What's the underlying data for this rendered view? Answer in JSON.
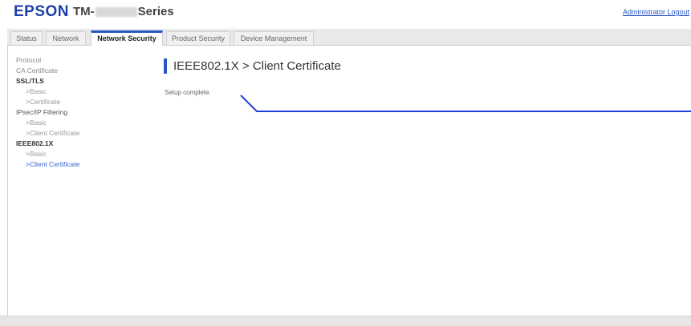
{
  "header": {
    "brand": "EPSON",
    "model_prefix": "TM-",
    "model_suffix": "Series",
    "admin_link": "Administrator Logout"
  },
  "tabs": [
    {
      "label": "Status"
    },
    {
      "label": "Network"
    },
    {
      "label": "Network Security"
    },
    {
      "label": "Product Security"
    },
    {
      "label": "Device Management"
    }
  ],
  "sidebar": {
    "items": [
      {
        "label": "Protocol"
      },
      {
        "label": "CA Certificate"
      },
      {
        "label": "SSL/TLS"
      },
      {
        "label": ">Basic"
      },
      {
        "label": ">Certificate"
      },
      {
        "label": "IPsec/IP Filtering"
      },
      {
        "label": ">Basic"
      },
      {
        "label": ">Client Certificate"
      },
      {
        "label": "IEEE802.1X"
      },
      {
        "label": ">Basic"
      },
      {
        "label": ">Client Certificate"
      }
    ]
  },
  "main": {
    "title": "IEEE802.1X > Client Certificate",
    "status_message": "Setup complete."
  },
  "colors": {
    "accent": "#2a55c5",
    "pointer_line": "#1f3fd6"
  }
}
